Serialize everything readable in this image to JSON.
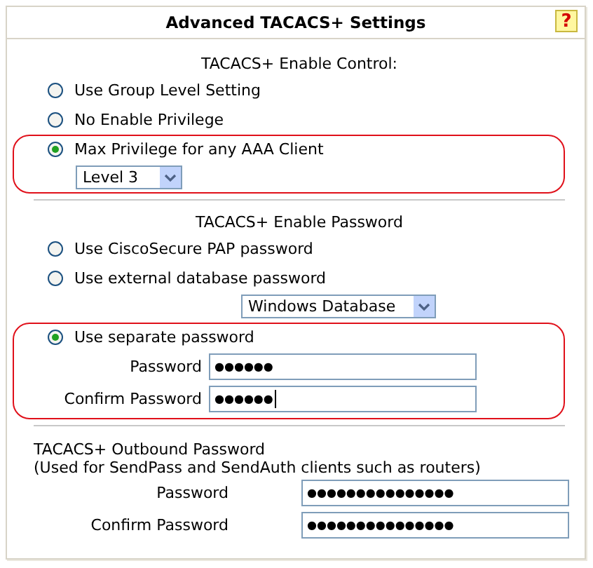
{
  "panel": {
    "title": "Advanced TACACS+ Settings",
    "help_icon": "?"
  },
  "enable_control": {
    "heading": "TACACS+ Enable Control:",
    "options": [
      {
        "label": "Use Group Level Setting",
        "selected": false,
        "highlighted": false
      },
      {
        "label": "No Enable Privilege",
        "selected": false,
        "highlighted": false
      },
      {
        "label": "Max Privilege for any AAA Client",
        "selected": true,
        "highlighted": true,
        "dropdown": {
          "value": "Level 3",
          "kind": "narrow"
        }
      }
    ]
  },
  "enable_password": {
    "heading": "TACACS+ Enable Password",
    "options": [
      {
        "label": "Use CiscoSecure PAP password",
        "selected": false,
        "highlighted": false
      },
      {
        "label": "Use external database password",
        "selected": false,
        "highlighted": false,
        "dropdown": {
          "value": "Windows Database",
          "kind": "wide"
        }
      },
      {
        "label": "Use separate password",
        "selected": true,
        "highlighted": true,
        "fields": [
          {
            "label": "Password",
            "value": "●●●●●●",
            "focused": false
          },
          {
            "label": "Confirm Password",
            "value": "●●●●●●",
            "focused": true
          }
        ]
      }
    ]
  },
  "outbound_password": {
    "heading": "TACACS+ Outbound Password",
    "note": "(Used for SendPass and SendAuth clients such as routers)",
    "fields": [
      {
        "label": "Password",
        "value": "●●●●●●●●●●●●●●●",
        "focused": false
      },
      {
        "label": "Confirm Password",
        "value": "●●●●●●●●●●●●●●●",
        "focused": false
      }
    ]
  }
}
